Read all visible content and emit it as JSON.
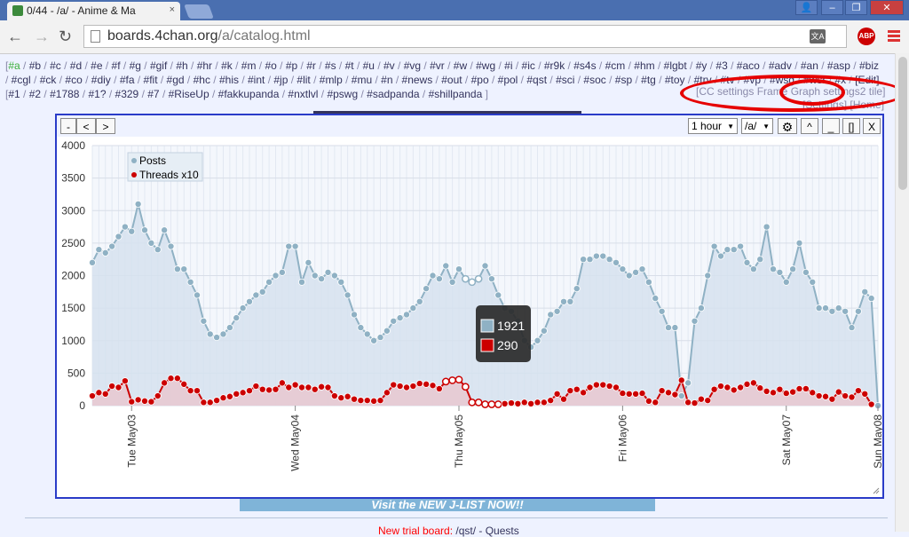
{
  "browser": {
    "tab_title": "0/44 - /a/ - Anime & Ma",
    "tab_close": "×",
    "url_host": "boards.4chan.org",
    "url_path": "/a/catalog.html",
    "abp_label": "ABP",
    "translate_label": "文A",
    "win_user": "👤",
    "win_min": "–",
    "win_max": "❐",
    "win_close": "✕"
  },
  "boardlinks": {
    "open": "[",
    "items": [
      "a",
      "b",
      "c",
      "d",
      "e",
      "f",
      "g",
      "gif",
      "h",
      "hr",
      "k",
      "m",
      "o",
      "p",
      "r",
      "s",
      "t",
      "u",
      "v",
      "vg",
      "vr",
      "w",
      "wg",
      "i",
      "ic",
      "r9k",
      "s4s",
      "cm",
      "hm",
      "lgbt",
      "y",
      "3",
      "aco",
      "adv",
      "an",
      "asp",
      "biz",
      "cgl",
      "ck",
      "co",
      "diy",
      "fa",
      "fit",
      "gd",
      "hc",
      "his",
      "int",
      "jp",
      "lit",
      "mlp",
      "mu",
      "n",
      "news",
      "out",
      "po",
      "pol",
      "qst",
      "sci",
      "soc",
      "sp",
      "tg",
      "toy",
      "trv",
      "tv",
      "vp",
      "wsg",
      "wsr",
      "x"
    ],
    "edit": "[Edit]",
    "custom": [
      "#1",
      "#2",
      "#1788",
      "#1?",
      "#329",
      "#7",
      "#RiseUp",
      "#fakkupanda",
      "#nxtlvl",
      "#pswg",
      "#sadpanda",
      "#shillpanda"
    ]
  },
  "cc_links": {
    "line1": "[CC settings Frame Graph settings2 tile]",
    "line2": "[Settings] [Home]"
  },
  "graph_window": {
    "btn_minus": "-",
    "btn_prev": "<",
    "btn_next": ">",
    "interval": "1 hour",
    "board": "/a/",
    "btn_gear": "⚙",
    "btn_up": "^",
    "btn_min": "_",
    "btn_max": "[]",
    "btn_close": "X"
  },
  "tooltip": {
    "posts_value": "1921",
    "threads_value": "290"
  },
  "footer": {
    "ad_text": "Visit the NEW J-LIST NOW!!",
    "trial_prefix": "New trial board: ",
    "trial_board": "/qst/ - Quests"
  },
  "colors": {
    "posts": "#8fb1c4",
    "posts_fill": "#d6e2ee",
    "threads": "#cc0000",
    "threads_fill": "#e8c8d0",
    "annotation": "#e60000",
    "window_border": "#2a3cc8"
  },
  "chart_data": {
    "type": "line",
    "x_labels": [
      "Tue May03",
      "Wed May04",
      "Thu May05",
      "Fri May06",
      "Sat May07",
      "Sun May08"
    ],
    "ylim": [
      0,
      4000
    ],
    "yticks": [
      0,
      500,
      1000,
      1500,
      2000,
      2500,
      3000,
      3500,
      4000
    ],
    "legend": "top-left",
    "grid": true,
    "series": [
      {
        "name": "Posts",
        "values": [
          2200,
          2400,
          2350,
          2450,
          2600,
          2750,
          2680,
          3100,
          2700,
          2500,
          2400,
          2700,
          2450,
          2100,
          2100,
          1900,
          1700,
          1300,
          1100,
          1050,
          1100,
          1200,
          1350,
          1500,
          1600,
          1700,
          1750,
          1900,
          2000,
          2050,
          2450,
          2450,
          1900,
          2200,
          2000,
          1950,
          2050,
          2000,
          1900,
          1700,
          1400,
          1200,
          1100,
          1000,
          1050,
          1150,
          1300,
          1350,
          1400,
          1500,
          1600,
          1800,
          2000,
          1950,
          2150,
          1900,
          2100,
          1950,
          1900,
          1950,
          2150,
          1950,
          1700,
          1500,
          1450,
          1300,
          1000,
          900,
          1000,
          1150,
          1400,
          1450,
          1600,
          1600,
          1800,
          2250,
          2250,
          2300,
          2300,
          2250,
          2200,
          2100,
          2000,
          2050,
          2100,
          1900,
          1650,
          1450,
          1200,
          1200,
          150,
          350,
          1300,
          1500,
          2000,
          2450,
          2300,
          2400,
          2400,
          2450,
          2200,
          2100,
          2250,
          2750,
          2100,
          2050,
          1900,
          2100,
          2500,
          2050,
          1900,
          1500,
          1500,
          1450,
          1500,
          1450,
          1200,
          1450,
          1750,
          1650,
          0
        ]
      },
      {
        "name": "Threads x10",
        "values": [
          150,
          200,
          180,
          300,
          280,
          380,
          60,
          90,
          70,
          60,
          150,
          350,
          420,
          420,
          330,
          230,
          230,
          50,
          50,
          80,
          120,
          140,
          180,
          200,
          230,
          300,
          250,
          240,
          250,
          350,
          280,
          320,
          280,
          280,
          250,
          290,
          280,
          150,
          120,
          140,
          100,
          80,
          80,
          70,
          80,
          200,
          320,
          300,
          280,
          300,
          340,
          330,
          310,
          260,
          370,
          390,
          400,
          290,
          50,
          50,
          20,
          20,
          20,
          30,
          40,
          30,
          50,
          30,
          50,
          50,
          80,
          180,
          100,
          230,
          250,
          200,
          280,
          320,
          320,
          300,
          280,
          190,
          180,
          180,
          190,
          70,
          50,
          230,
          200,
          170,
          390,
          50,
          40,
          100,
          80,
          250,
          300,
          280,
          240,
          280,
          330,
          350,
          270,
          220,
          200,
          250,
          190,
          210,
          260,
          260,
          200,
          150,
          140,
          100,
          210,
          150,
          130,
          230,
          180,
          20
        ]
      }
    ]
  }
}
